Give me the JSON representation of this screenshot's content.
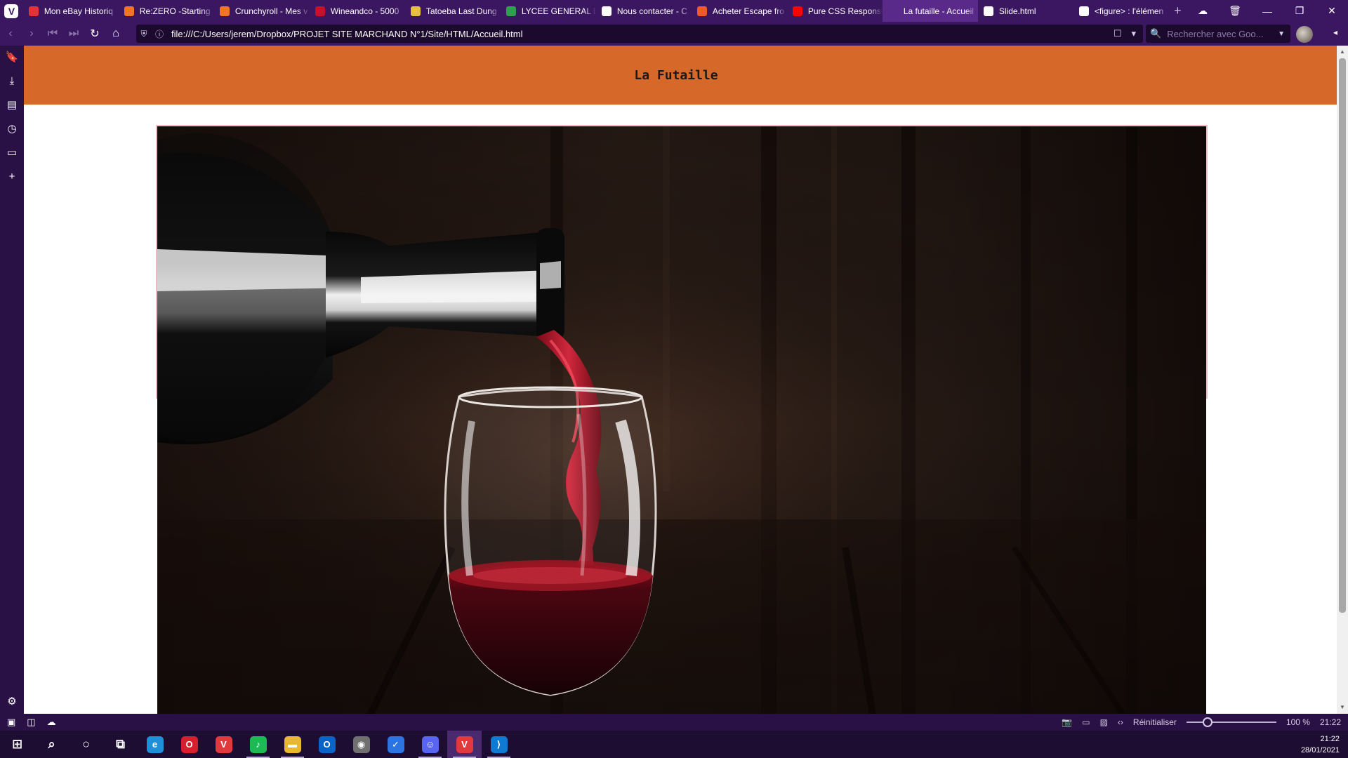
{
  "browser": {
    "tabs": [
      {
        "label": "Mon eBay Historiq",
        "icon": "ebay-icon",
        "color": "#e53238"
      },
      {
        "label": "Re:ZERO -Starting",
        "icon": "crunchyroll-icon",
        "color": "#f47521"
      },
      {
        "label": "Crunchyroll - Mes v",
        "icon": "crunchyroll-icon",
        "color": "#f47521"
      },
      {
        "label": "Wineandco - 5000",
        "icon": "wineandco-icon",
        "color": "#c8102e"
      },
      {
        "label": "Tatoeba Last Dung",
        "icon": "tatoeba-icon",
        "color": "#e8c040"
      },
      {
        "label": "LYCEE GENERAL ET",
        "icon": "school-icon",
        "color": "#2e9e4f"
      },
      {
        "label": "Nous contacter - C",
        "icon": "contact-icon",
        "color": "#ffffff"
      },
      {
        "label": "Acheter Escape fro",
        "icon": "ig-icon",
        "color": "#f05a28"
      },
      {
        "label": "Pure CSS Responsi",
        "icon": "youtube-icon",
        "color": "#ff0000"
      },
      {
        "label": "La futaille - Accueil",
        "icon": "page-icon",
        "color": "#5a2a8a",
        "active": true
      },
      {
        "label": "Slide.html",
        "icon": "file-icon",
        "color": "#ffffff"
      },
      {
        "label": "<figure> : l'élémen",
        "icon": "mdn-icon",
        "color": "#ffffff"
      }
    ],
    "new_tab": "+",
    "window_controls": {
      "cloud": "☁",
      "trash": "🗑",
      "minimize": "—",
      "restore": "❐",
      "close": "✕"
    },
    "address": {
      "url": "file:///C:/Users/jerem/Dropbox/PROJET SITE MARCHAND N°1/Site/HTML/Accueil.html"
    },
    "search": {
      "placeholder": "Rechercher avec Goo..."
    },
    "status": {
      "reset": "Réinitialiser",
      "zoom_percent": 100,
      "zoom_label": "100 %",
      "time": "21:22"
    }
  },
  "page": {
    "site_title": "La Futaille",
    "header_color": "#d6692a",
    "hero_alt": "Vin rouge versé dans un verre"
  },
  "taskbar": {
    "clock_time": "21:22",
    "clock_date": "28/01/2021",
    "apps": [
      {
        "name": "windows-start-icon",
        "running": false
      },
      {
        "name": "search-icon",
        "running": false
      },
      {
        "name": "cortana-icon",
        "running": false
      },
      {
        "name": "task-view-icon",
        "running": false
      },
      {
        "name": "edge-icon",
        "running": false
      },
      {
        "name": "opera-icon",
        "running": false
      },
      {
        "name": "vivaldi-icon",
        "running": false
      },
      {
        "name": "spotify-icon",
        "running": true
      },
      {
        "name": "file-explorer-icon",
        "running": true
      },
      {
        "name": "outlook-icon",
        "running": false
      },
      {
        "name": "app-icon",
        "running": false
      },
      {
        "name": "todo-icon",
        "running": false
      },
      {
        "name": "discord-icon",
        "running": true
      },
      {
        "name": "vivaldi-running-icon",
        "running": true
      },
      {
        "name": "vscode-icon",
        "running": true
      }
    ]
  }
}
